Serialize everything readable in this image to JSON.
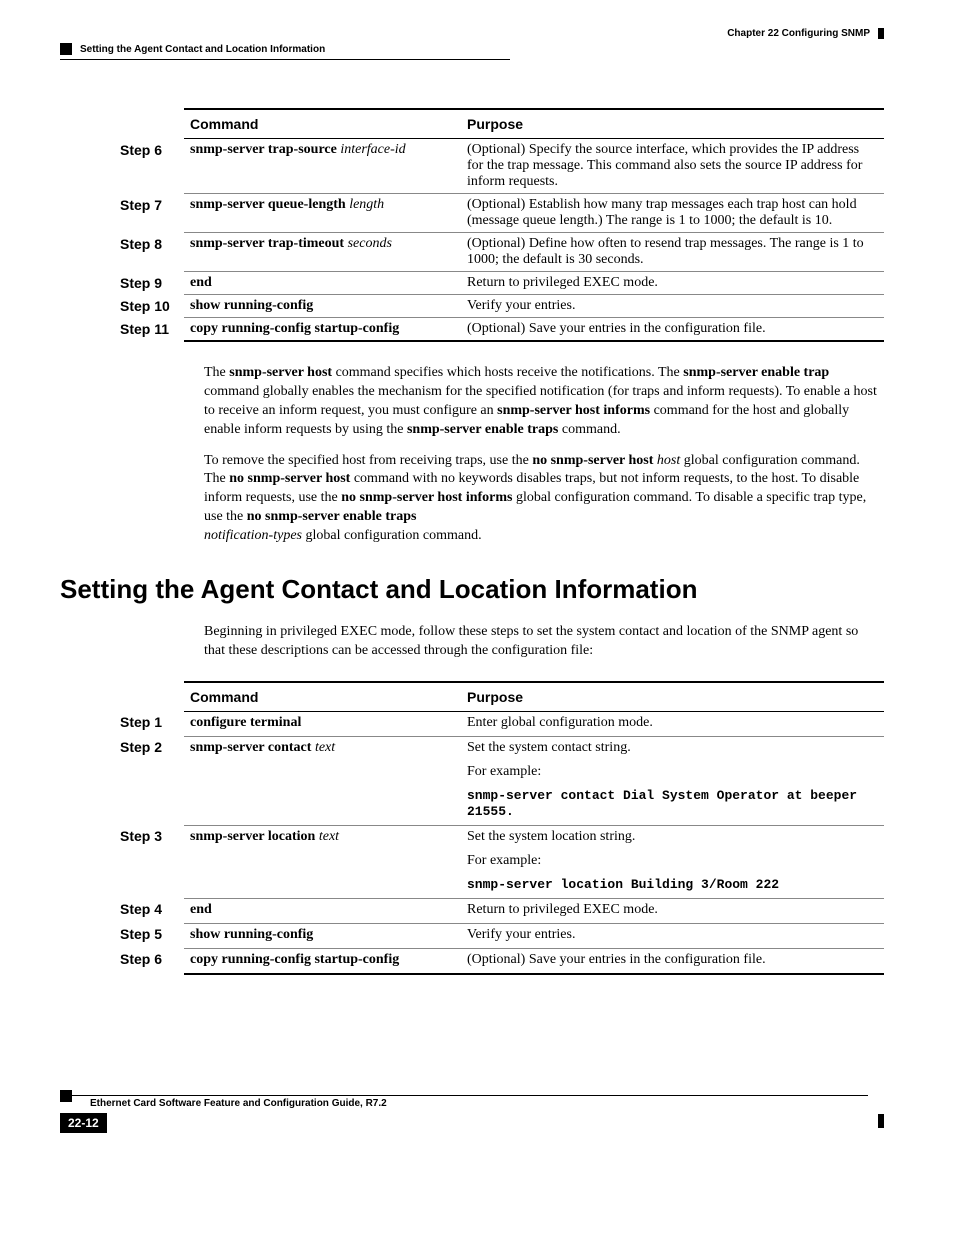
{
  "header": {
    "chapter": "Chapter 22  Configuring SNMP",
    "section": "Setting the Agent Contact and Location Information"
  },
  "table1": {
    "headers": {
      "command": "Command",
      "purpose": "Purpose"
    },
    "rows": [
      {
        "step": "Step 6",
        "cmd_bold": "snmp-server trap-source",
        "cmd_ital": " interface-id",
        "purpose": "(Optional) Specify the source interface, which provides the IP address for the trap message. This command also sets the source IP address for inform requests."
      },
      {
        "step": "Step 7",
        "cmd_bold": "snmp-server queue-length",
        "cmd_ital": " length",
        "purpose": "(Optional) Establish how many trap messages each trap host can hold (message queue length.) The range is 1 to 1000; the default is 10."
      },
      {
        "step": "Step 8",
        "cmd_bold": "snmp-server trap-timeout",
        "cmd_ital": " seconds",
        "purpose": "(Optional) Define how often to resend trap messages. The range is 1 to 1000; the default is 30 seconds."
      },
      {
        "step": "Step 9",
        "cmd_bold": "end",
        "cmd_ital": "",
        "purpose": "Return to privileged EXEC mode."
      },
      {
        "step": "Step 10",
        "cmd_bold": "show running-config",
        "cmd_ital": "",
        "purpose": "Verify your entries."
      },
      {
        "step": "Step 11",
        "cmd_bold": "copy running-config startup-config",
        "cmd_ital": "",
        "purpose": "(Optional) Save your entries in the configuration file."
      }
    ]
  },
  "para1": {
    "t1": "The ",
    "b1": "snmp-server host",
    "t2": " command specifies which hosts receive the notifications. The ",
    "b2": "snmp-server enable trap",
    "t3": " command globally enables the mechanism for the specified notification (for traps and inform requests). To enable a host to receive an inform request, you must configure an ",
    "b3": "snmp-server host informs",
    "t4": " command for the host and globally enable inform requests by using the ",
    "b4": "snmp-server enable traps",
    "t5": " command."
  },
  "para2": {
    "t1": "To remove the specified host from receiving traps, use the ",
    "b1": "no snmp-server host",
    "i1": " host",
    "t2": " global configuration command. The ",
    "b2": "no snmp-server host",
    "t3": " command with no keywords disables traps, but not inform requests, to the host. To disable inform requests, use the ",
    "b3": "no snmp-server host informs",
    "t4": " global configuration command. To disable a specific trap type, use the ",
    "b4": "no snmp-server enable traps",
    "i2": " notification-types",
    "t5": " global configuration command."
  },
  "section_heading": "Setting the Agent Contact and Location Information",
  "intro2": "Beginning in privileged EXEC mode, follow these steps to set the system contact and location of the SNMP agent so that these descriptions can be accessed through the configuration file:",
  "table2": {
    "headers": {
      "command": "Command",
      "purpose": "Purpose"
    },
    "rows": [
      {
        "step": "Step 1",
        "cmd_bold": "configure terminal",
        "cmd_ital": "",
        "purpose_lines": [
          "Enter global configuration mode."
        ],
        "mono": ""
      },
      {
        "step": "Step 2",
        "cmd_bold": "snmp-server contact",
        "cmd_ital": " text",
        "purpose_lines": [
          "Set the system contact string.",
          "For example:"
        ],
        "mono": "snmp-server contact Dial System Operator at beeper 21555."
      },
      {
        "step": "Step 3",
        "cmd_bold": "snmp-server location",
        "cmd_ital": " text",
        "purpose_lines": [
          "Set the system location string.",
          "For example:"
        ],
        "mono": "snmp-server location Building 3/Room 222"
      },
      {
        "step": "Step 4",
        "cmd_bold": "end",
        "cmd_ital": "",
        "purpose_lines": [
          "Return to privileged EXEC mode."
        ],
        "mono": ""
      },
      {
        "step": "Step 5",
        "cmd_bold": "show running-config",
        "cmd_ital": "",
        "purpose_lines": [
          "Verify your entries."
        ],
        "mono": ""
      },
      {
        "step": "Step 6",
        "cmd_bold": "copy running-config startup-config",
        "cmd_ital": "",
        "purpose_lines": [
          "(Optional) Save your entries in the configuration file."
        ],
        "mono": ""
      }
    ]
  },
  "footer": {
    "title": "Ethernet Card Software Feature and Configuration Guide, R7.2",
    "page": "22-12"
  }
}
